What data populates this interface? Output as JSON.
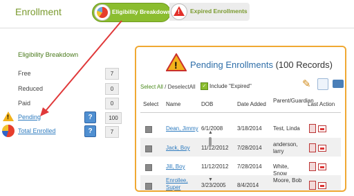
{
  "header": {
    "title": "Enrollment",
    "tabs": [
      {
        "label": "Eligibility Breakdown",
        "active": true,
        "icon": "pie-chart-icon"
      },
      {
        "label": "Expired Enrollments",
        "active": false,
        "icon": "warning-icon"
      }
    ]
  },
  "sidebar": {
    "title": "Eligibility Breakdown",
    "items": [
      {
        "label": "Free",
        "count": "7"
      },
      {
        "label": "Reduced",
        "count": "0"
      },
      {
        "label": "Paid",
        "count": "0"
      },
      {
        "label": "Pending",
        "count": "100",
        "icon": "warning-icon"
      },
      {
        "label": "Total Enrolled",
        "count": "7",
        "icon": "pie-chart-icon"
      }
    ],
    "help_symbol": "?"
  },
  "panel": {
    "title": "Pending Enrollments",
    "record_count": "(100 Records)",
    "select_all": "Select All",
    "separator": " / ",
    "deselect_all": "DeselectAll",
    "include_expired": "Include \"Expired\"",
    "columns": [
      "Select",
      "Name",
      "DOB",
      "Date Added",
      "Parent/Guardian",
      "Last Action"
    ],
    "rows": [
      {
        "name": "Dean, Jimmy",
        "dob": "6/1/2008",
        "date_added": "3/18/2014",
        "parent": "Test, Linda"
      },
      {
        "name": "Jack, Boy",
        "dob": "11/12/2012",
        "date_added": "7/28/2014",
        "parent": "anderson, larry"
      },
      {
        "name": "Jill, Boy",
        "dob": "11/12/2012",
        "date_added": "7/28/2014",
        "parent": "White, Snow"
      },
      {
        "name": "Enrollee, Super",
        "dob": "3/23/2005",
        "date_added": "8/4/2014",
        "parent": "Moore, Bob"
      }
    ]
  },
  "colors": {
    "accent_green": "#8bbd2f",
    "panel_border": "#f0a832",
    "link_blue": "#2e7bbf",
    "arrow_red": "#e0393a"
  }
}
